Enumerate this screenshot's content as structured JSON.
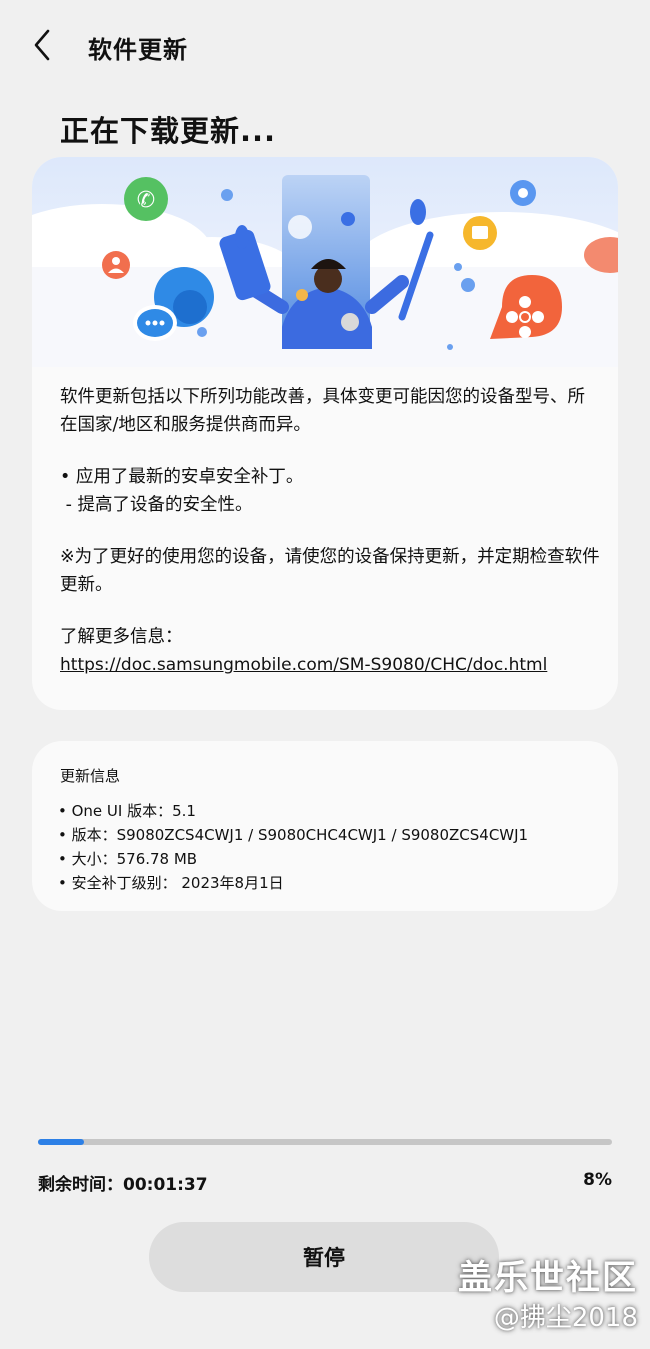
{
  "appbar": {
    "title": "软件更新",
    "back_icon": "chevron-left-icon"
  },
  "heading": "正在下载更新...",
  "release_notes": {
    "line1": "软件更新包括以下所列功能改善，具体变更可能因您的设备型号、所在国家/地区和服务提供商而异。",
    "bullet": "• 应用了最新的安卓安全补丁。",
    "sub_bullet": " - 提高了设备的安全性。",
    "note": "※为了更好的使用您的设备，请使您的设备保持更新，并定期检查软件更新。",
    "more_label": "了解更多信息：",
    "link": "https://doc.samsungmobile.com/SM-S9080/CHC/doc.html"
  },
  "update_info": {
    "title": "更新信息",
    "items": [
      "• One UI 版本：5.1",
      "• 版本：S9080ZCS4CWJ1 / S9080CHC4CWJ1 / S9080ZCS4CWJ1",
      "• 大小：576.78 MB",
      "• 安全补丁级别： 2023年8月1日"
    ]
  },
  "progress": {
    "fraction": 0.08,
    "remaining": "剩余时间：00:01:37",
    "percent_label": "8%"
  },
  "pause_button": "暂停",
  "watermark": {
    "line1": "盖乐世社区",
    "line2": "@拂尘2018"
  },
  "colors": {
    "background": "#f0f0f0",
    "card": "#fafafa",
    "progress_fill": "#2d80e6",
    "progress_track": "#c6c6c6",
    "button": "#dddddd"
  },
  "hero_icons": [
    "phone-bubble-icon",
    "chat-bubble-icon",
    "person-bubble-icon",
    "gear-icon",
    "folder-icon",
    "flower-icon",
    "person-illustration"
  ]
}
